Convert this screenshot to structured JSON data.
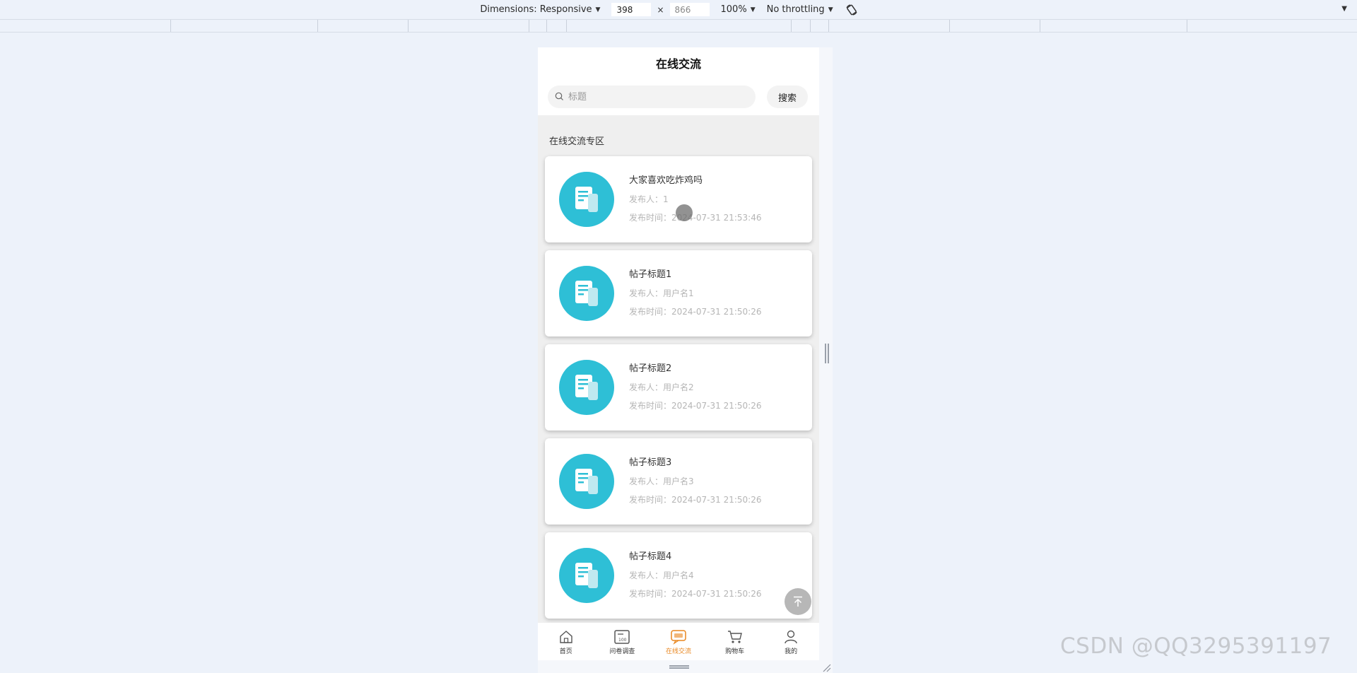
{
  "devtools": {
    "dimensions_label": "Dimensions: Responsive",
    "width": "398",
    "height_placeholder": "866",
    "times": "×",
    "zoom": "100%",
    "throttling": "No throttling"
  },
  "page": {
    "title": "在线交流",
    "search": {
      "placeholder": "标题",
      "button": "搜索"
    },
    "section_title": "在线交流专区",
    "posts": [
      {
        "title": "大家喜欢吃炸鸡吗",
        "author_label": "发布人：",
        "author": "1",
        "time_label": "发布时间：",
        "time": "2024-07-31 21:53:46"
      },
      {
        "title": "帖子标题1",
        "author_label": "发布人：",
        "author": "用户名1",
        "time_label": "发布时间：",
        "time": "2024-07-31 21:50:26"
      },
      {
        "title": "帖子标题2",
        "author_label": "发布人：",
        "author": "用户名2",
        "time_label": "发布时间：",
        "time": "2024-07-31 21:50:26"
      },
      {
        "title": "帖子标题3",
        "author_label": "发布人：",
        "author": "用户名3",
        "time_label": "发布时间：",
        "time": "2024-07-31 21:50:26"
      },
      {
        "title": "帖子标题4",
        "author_label": "发布人：",
        "author": "用户名4",
        "time_label": "发布时间：",
        "time": "2024-07-31 21:50:26"
      }
    ]
  },
  "tabbar": {
    "items": [
      {
        "label": "首页",
        "icon": "home-icon"
      },
      {
        "label": "问卷调查",
        "icon": "survey-icon"
      },
      {
        "label": "在线交流",
        "icon": "chat-icon",
        "active": true
      },
      {
        "label": "购物车",
        "icon": "cart-icon"
      },
      {
        "label": "我的",
        "icon": "user-icon"
      }
    ]
  },
  "colors": {
    "accent": "#e8861f",
    "avatar": "#2ebfd6",
    "background": "#edf2fa"
  },
  "watermark": "CSDN @QQ3295391197"
}
